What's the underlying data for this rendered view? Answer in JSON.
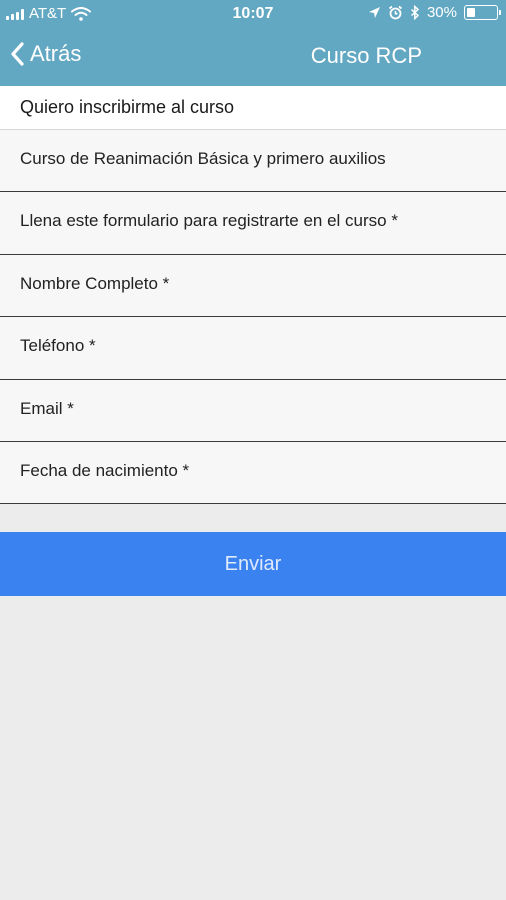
{
  "status_bar": {
    "carrier": "AT&T",
    "time": "10:07",
    "battery": "30%",
    "battery_level": 0.3,
    "icons": [
      "signal-icon",
      "wifi-icon",
      "location-icon",
      "alarm-icon",
      "bluetooth-icon",
      "battery-icon"
    ]
  },
  "nav": {
    "back_label": "Atrás",
    "back_icon": "chevron-left-icon",
    "title": "Curso RCP"
  },
  "form": {
    "header": "Quiero inscribirme al curso",
    "rows": [
      "Curso de Reanimación Básica y primero auxilios",
      "Llena este formulario para registrarte en el curso *",
      "Nombre Completo *",
      "Teléfono *",
      "Email *",
      "Fecha de nacimiento *"
    ],
    "submit_label": "Enviar"
  },
  "colors": {
    "nav_bar": "#63a8c2",
    "submit_button": "#3b82f1",
    "background": "#ececec"
  }
}
